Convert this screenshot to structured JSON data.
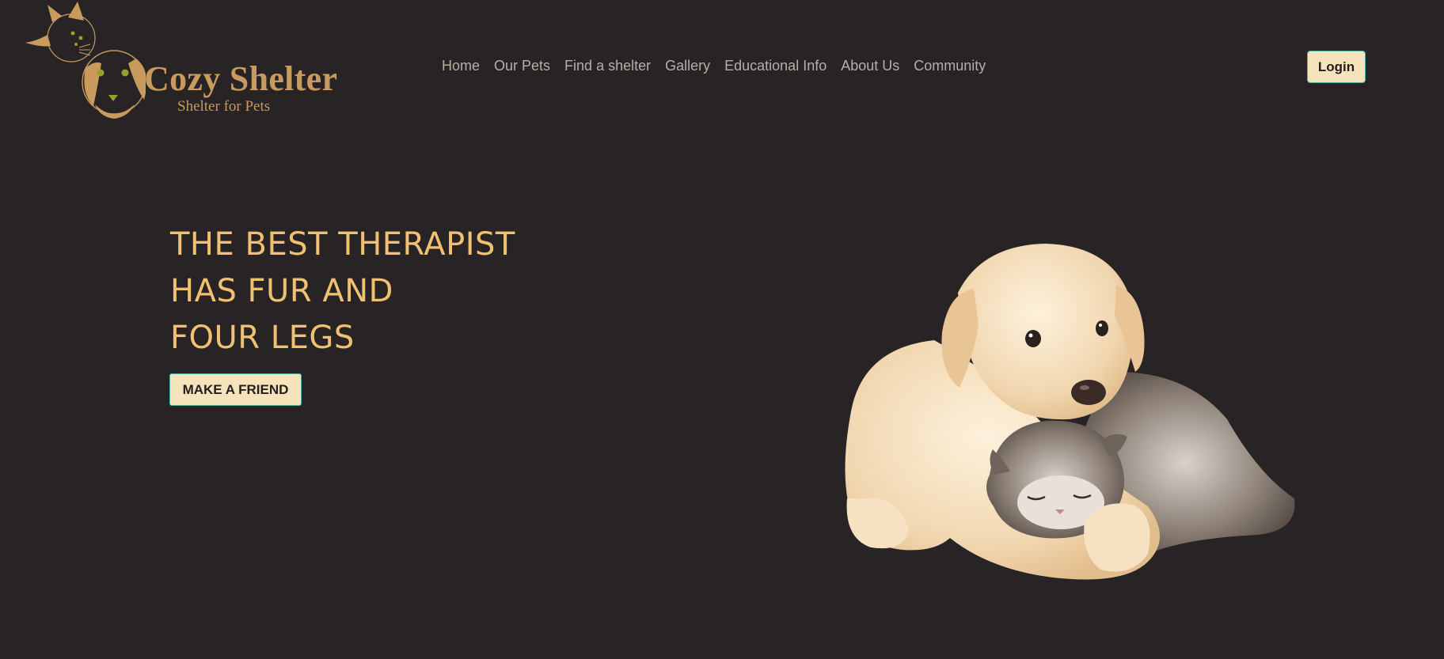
{
  "brand": {
    "name": "Cozy Shelter",
    "tagline": "Shelter for Pets",
    "logo_icon": "dog-cat-logo-icon"
  },
  "nav": {
    "items": [
      "Home",
      "Our Pets",
      "Find a shelter",
      "Gallery",
      "Educational Info",
      "About Us",
      "Community"
    ]
  },
  "header": {
    "login_label": "Login"
  },
  "hero": {
    "title_lines": [
      "THE BEST THERAPIST",
      "HAS FUR AND",
      "FOUR LEGS"
    ],
    "cta_label": "MAKE A FRIEND",
    "image_icon": "puppy-and-kitten-image"
  },
  "colors": {
    "background": "#282324",
    "accent": "#efc171",
    "brand": "#c89a5e",
    "button_bg": "#f5e3bc",
    "button_border": "#4fb0a0",
    "nav_text": "#b7aea7"
  }
}
